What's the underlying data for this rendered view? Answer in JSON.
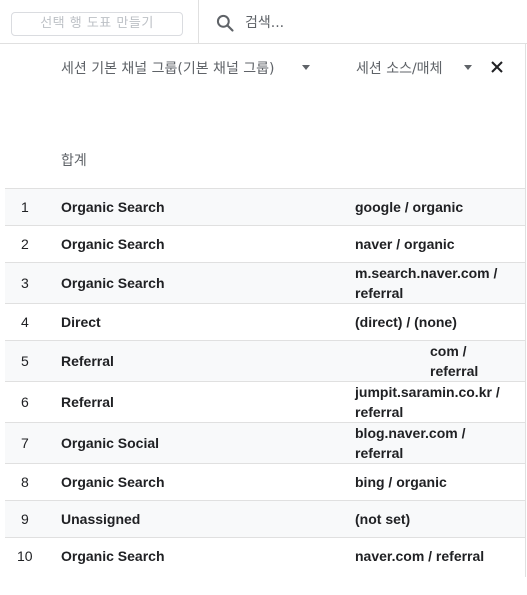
{
  "toolbar": {
    "chart_button_label": "선택 행 도표 만들기",
    "search_placeholder": "검색..."
  },
  "table": {
    "dimension1_header": "세션 기본 채널 그룹(기본 채널 그룹)",
    "dimension2_header": "세션 소스/매체",
    "total_label": "합계",
    "rows": [
      {
        "num": "1",
        "channel": "Organic Search",
        "source": "google / organic"
      },
      {
        "num": "2",
        "channel": "Organic Search",
        "source": "naver / organic"
      },
      {
        "num": "3",
        "channel": "Organic Search",
        "source": "m.search.naver.com / referral"
      },
      {
        "num": "4",
        "channel": "Direct",
        "source": "(direct) / (none)"
      },
      {
        "num": "5",
        "channel": "Referral",
        "source": "com / referral"
      },
      {
        "num": "6",
        "channel": "Referral",
        "source": "jumpit.saramin.co.kr / referral"
      },
      {
        "num": "7",
        "channel": "Organic Social",
        "source": "blog.naver.com / referral"
      },
      {
        "num": "8",
        "channel": "Organic Search",
        "source": "bing / organic"
      },
      {
        "num": "9",
        "channel": "Unassigned",
        "source": "(not set)"
      },
      {
        "num": "10",
        "channel": "Organic Search",
        "source": "naver.com / referral"
      }
    ]
  }
}
